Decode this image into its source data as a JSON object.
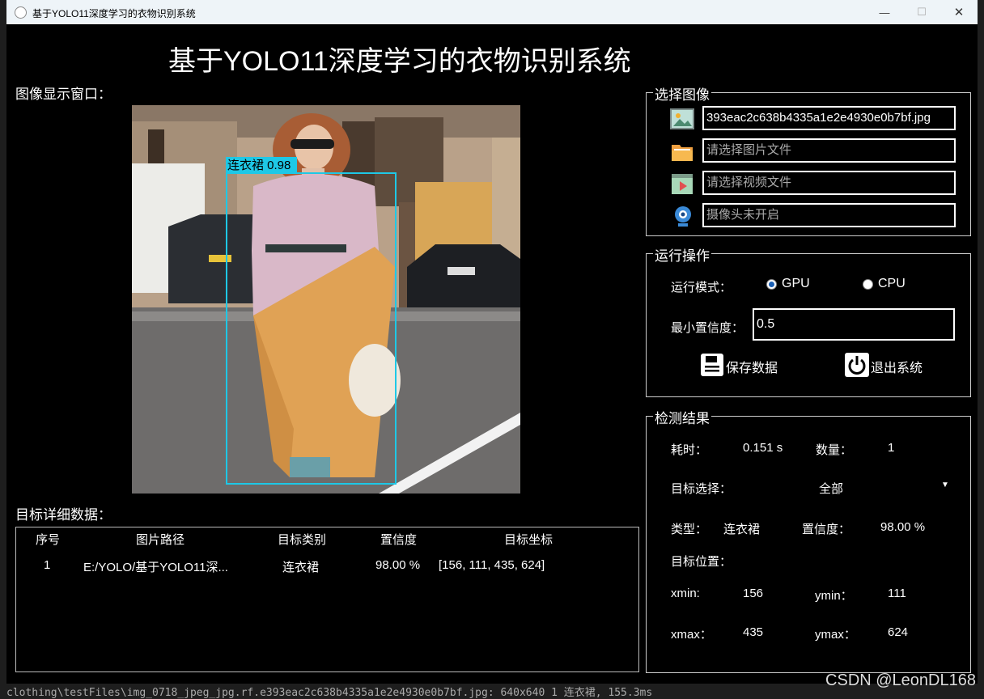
{
  "window": {
    "title": "基于YOLO11深度学习的衣物识别系统",
    "minimize": "—",
    "maximize": "☐",
    "close": "✕"
  },
  "header": {
    "title": "基于YOLO11深度学习的衣物识别系统"
  },
  "display": {
    "label": "图像显示窗口：",
    "detection_label": "连衣裙 0.98"
  },
  "details": {
    "label": "目标详细数据：",
    "columns": [
      "序号",
      "图片路径",
      "目标类别",
      "置信度",
      "目标坐标"
    ],
    "rows": [
      [
        "1",
        "E:/YOLO/基于YOLO11深...",
        "连衣裙",
        "98.00 %",
        "[156, 111, 435, 624]"
      ]
    ]
  },
  "select": {
    "legend": "选择图像",
    "image_value": "393eac2c638b4335a1e2e4930e0b7bf.jpg",
    "folder_placeholder": "请选择图片文件",
    "video_placeholder": "请选择视频文件",
    "camera_placeholder": "摄像头未开启"
  },
  "run": {
    "legend": "运行操作",
    "mode_label": "运行模式：",
    "gpu": "GPU",
    "cpu": "CPU",
    "selected_mode": "GPU",
    "conf_label": "最小置信度：",
    "conf_value": "0.5",
    "save_label": "保存数据",
    "exit_label": "退出系统"
  },
  "result": {
    "legend": "检测结果",
    "time_label": "耗时：",
    "time_value": "0.151 s",
    "count_label": "数量：",
    "count_value": "1",
    "target_label": "目标选择：",
    "target_value": "全部",
    "type_label": "类型：",
    "type_value": "连衣裙",
    "conf_label": "置信度：",
    "conf_value": "98.00 %",
    "pos_label": "目标位置：",
    "xmin_label": "xmin:",
    "xmin_value": "156",
    "ymin_label": "ymin：",
    "ymin_value": "111",
    "xmax_label": "xmax：",
    "xmax_value": "435",
    "ymax_label": "ymax：",
    "ymax_value": "624"
  },
  "watermark": "CSDN @LeonDL168",
  "console_text": "clothing\\testFiles\\img_0718_jpeg_jpg.rf.e393eac2c638b4335a1e2e4930e0b7bf.jpg: 640x640 1 连衣裙, 155.3ms"
}
